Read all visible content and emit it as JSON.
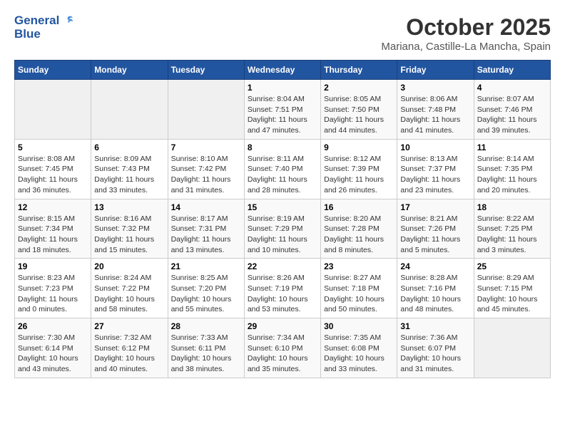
{
  "header": {
    "logo_line1": "General",
    "logo_line2": "Blue",
    "title": "October 2025",
    "subtitle": "Mariana, Castille-La Mancha, Spain"
  },
  "days_of_week": [
    "Sunday",
    "Monday",
    "Tuesday",
    "Wednesday",
    "Thursday",
    "Friday",
    "Saturday"
  ],
  "weeks": [
    [
      {
        "day": "",
        "sunrise": "",
        "sunset": "",
        "daylight": "",
        "empty": true
      },
      {
        "day": "",
        "sunrise": "",
        "sunset": "",
        "daylight": "",
        "empty": true
      },
      {
        "day": "",
        "sunrise": "",
        "sunset": "",
        "daylight": "",
        "empty": true
      },
      {
        "day": "1",
        "sunrise": "Sunrise: 8:04 AM",
        "sunset": "Sunset: 7:51 PM",
        "daylight": "Daylight: 11 hours and 47 minutes."
      },
      {
        "day": "2",
        "sunrise": "Sunrise: 8:05 AM",
        "sunset": "Sunset: 7:50 PM",
        "daylight": "Daylight: 11 hours and 44 minutes."
      },
      {
        "day": "3",
        "sunrise": "Sunrise: 8:06 AM",
        "sunset": "Sunset: 7:48 PM",
        "daylight": "Daylight: 11 hours and 41 minutes."
      },
      {
        "day": "4",
        "sunrise": "Sunrise: 8:07 AM",
        "sunset": "Sunset: 7:46 PM",
        "daylight": "Daylight: 11 hours and 39 minutes."
      }
    ],
    [
      {
        "day": "5",
        "sunrise": "Sunrise: 8:08 AM",
        "sunset": "Sunset: 7:45 PM",
        "daylight": "Daylight: 11 hours and 36 minutes."
      },
      {
        "day": "6",
        "sunrise": "Sunrise: 8:09 AM",
        "sunset": "Sunset: 7:43 PM",
        "daylight": "Daylight: 11 hours and 33 minutes."
      },
      {
        "day": "7",
        "sunrise": "Sunrise: 8:10 AM",
        "sunset": "Sunset: 7:42 PM",
        "daylight": "Daylight: 11 hours and 31 minutes."
      },
      {
        "day": "8",
        "sunrise": "Sunrise: 8:11 AM",
        "sunset": "Sunset: 7:40 PM",
        "daylight": "Daylight: 11 hours and 28 minutes."
      },
      {
        "day": "9",
        "sunrise": "Sunrise: 8:12 AM",
        "sunset": "Sunset: 7:39 PM",
        "daylight": "Daylight: 11 hours and 26 minutes."
      },
      {
        "day": "10",
        "sunrise": "Sunrise: 8:13 AM",
        "sunset": "Sunset: 7:37 PM",
        "daylight": "Daylight: 11 hours and 23 minutes."
      },
      {
        "day": "11",
        "sunrise": "Sunrise: 8:14 AM",
        "sunset": "Sunset: 7:35 PM",
        "daylight": "Daylight: 11 hours and 20 minutes."
      }
    ],
    [
      {
        "day": "12",
        "sunrise": "Sunrise: 8:15 AM",
        "sunset": "Sunset: 7:34 PM",
        "daylight": "Daylight: 11 hours and 18 minutes."
      },
      {
        "day": "13",
        "sunrise": "Sunrise: 8:16 AM",
        "sunset": "Sunset: 7:32 PM",
        "daylight": "Daylight: 11 hours and 15 minutes."
      },
      {
        "day": "14",
        "sunrise": "Sunrise: 8:17 AM",
        "sunset": "Sunset: 7:31 PM",
        "daylight": "Daylight: 11 hours and 13 minutes."
      },
      {
        "day": "15",
        "sunrise": "Sunrise: 8:19 AM",
        "sunset": "Sunset: 7:29 PM",
        "daylight": "Daylight: 11 hours and 10 minutes."
      },
      {
        "day": "16",
        "sunrise": "Sunrise: 8:20 AM",
        "sunset": "Sunset: 7:28 PM",
        "daylight": "Daylight: 11 hours and 8 minutes."
      },
      {
        "day": "17",
        "sunrise": "Sunrise: 8:21 AM",
        "sunset": "Sunset: 7:26 PM",
        "daylight": "Daylight: 11 hours and 5 minutes."
      },
      {
        "day": "18",
        "sunrise": "Sunrise: 8:22 AM",
        "sunset": "Sunset: 7:25 PM",
        "daylight": "Daylight: 11 hours and 3 minutes."
      }
    ],
    [
      {
        "day": "19",
        "sunrise": "Sunrise: 8:23 AM",
        "sunset": "Sunset: 7:23 PM",
        "daylight": "Daylight: 11 hours and 0 minutes."
      },
      {
        "day": "20",
        "sunrise": "Sunrise: 8:24 AM",
        "sunset": "Sunset: 7:22 PM",
        "daylight": "Daylight: 10 hours and 58 minutes."
      },
      {
        "day": "21",
        "sunrise": "Sunrise: 8:25 AM",
        "sunset": "Sunset: 7:20 PM",
        "daylight": "Daylight: 10 hours and 55 minutes."
      },
      {
        "day": "22",
        "sunrise": "Sunrise: 8:26 AM",
        "sunset": "Sunset: 7:19 PM",
        "daylight": "Daylight: 10 hours and 53 minutes."
      },
      {
        "day": "23",
        "sunrise": "Sunrise: 8:27 AM",
        "sunset": "Sunset: 7:18 PM",
        "daylight": "Daylight: 10 hours and 50 minutes."
      },
      {
        "day": "24",
        "sunrise": "Sunrise: 8:28 AM",
        "sunset": "Sunset: 7:16 PM",
        "daylight": "Daylight: 10 hours and 48 minutes."
      },
      {
        "day": "25",
        "sunrise": "Sunrise: 8:29 AM",
        "sunset": "Sunset: 7:15 PM",
        "daylight": "Daylight: 10 hours and 45 minutes."
      }
    ],
    [
      {
        "day": "26",
        "sunrise": "Sunrise: 7:30 AM",
        "sunset": "Sunset: 6:14 PM",
        "daylight": "Daylight: 10 hours and 43 minutes."
      },
      {
        "day": "27",
        "sunrise": "Sunrise: 7:32 AM",
        "sunset": "Sunset: 6:12 PM",
        "daylight": "Daylight: 10 hours and 40 minutes."
      },
      {
        "day": "28",
        "sunrise": "Sunrise: 7:33 AM",
        "sunset": "Sunset: 6:11 PM",
        "daylight": "Daylight: 10 hours and 38 minutes."
      },
      {
        "day": "29",
        "sunrise": "Sunrise: 7:34 AM",
        "sunset": "Sunset: 6:10 PM",
        "daylight": "Daylight: 10 hours and 35 minutes."
      },
      {
        "day": "30",
        "sunrise": "Sunrise: 7:35 AM",
        "sunset": "Sunset: 6:08 PM",
        "daylight": "Daylight: 10 hours and 33 minutes."
      },
      {
        "day": "31",
        "sunrise": "Sunrise: 7:36 AM",
        "sunset": "Sunset: 6:07 PM",
        "daylight": "Daylight: 10 hours and 31 minutes."
      },
      {
        "day": "",
        "sunrise": "",
        "sunset": "",
        "daylight": "",
        "empty": true
      }
    ]
  ]
}
